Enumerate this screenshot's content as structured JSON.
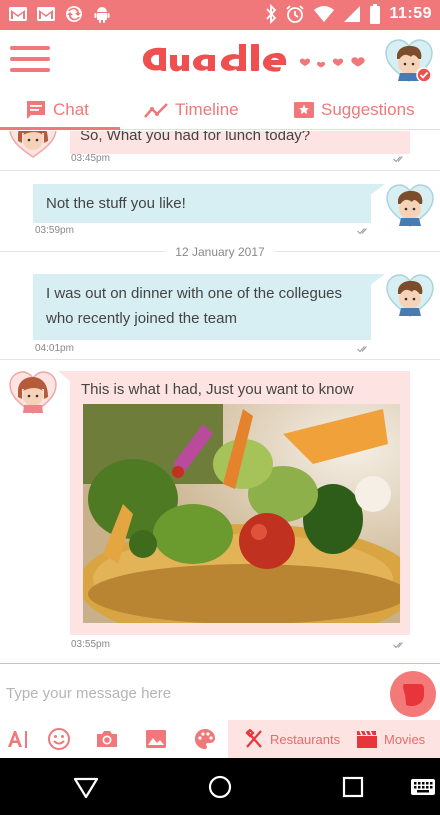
{
  "status_bar": {
    "time": "11:59",
    "left_icons": [
      "gmail-icon",
      "gmail-icon",
      "sync-icon",
      "android-icon"
    ],
    "right_icons": [
      "bluetooth-icon",
      "alarm-icon",
      "wifi-icon",
      "signal-icon",
      "battery-icon"
    ]
  },
  "app": {
    "brand": "duadle",
    "colors": {
      "accent": "#f0787a",
      "incoming": "#fde3e1",
      "outgoing": "#d7eef2"
    }
  },
  "tabs": [
    {
      "label": "Chat",
      "icon": "chat-icon",
      "active": true
    },
    {
      "label": "Timeline",
      "icon": "timeline-icon",
      "active": false
    },
    {
      "label": "Suggestions",
      "icon": "star-icon",
      "active": false
    }
  ],
  "messages": [
    {
      "direction": "in",
      "text": "So, What you had for lunch today?",
      "time": "03:45pm"
    },
    {
      "direction": "out",
      "text": "Not the stuff you like!",
      "time": "03:59pm"
    },
    {
      "date_separator": "12 January 2017"
    },
    {
      "direction": "out",
      "text": "I was out on dinner with one of the collegues who recently joined the team",
      "time": "04:01pm"
    },
    {
      "direction": "in",
      "text": "This is what I had, Just you want to know",
      "time": "03:55pm",
      "has_photo": true
    }
  ],
  "composer": {
    "placeholder": "Type your message here"
  },
  "toolbar": {
    "tools": [
      "text-format-icon",
      "emoji-icon",
      "camera-icon",
      "image-icon",
      "palette-icon"
    ],
    "shortcuts": [
      {
        "label": "Restaurants",
        "icon": "fork-knife-icon"
      },
      {
        "label": "Movies",
        "icon": "clapperboard-icon"
      }
    ]
  },
  "nav_bar": {
    "buttons": [
      "back-icon",
      "home-icon",
      "recents-icon",
      "keyboard-icon"
    ]
  }
}
